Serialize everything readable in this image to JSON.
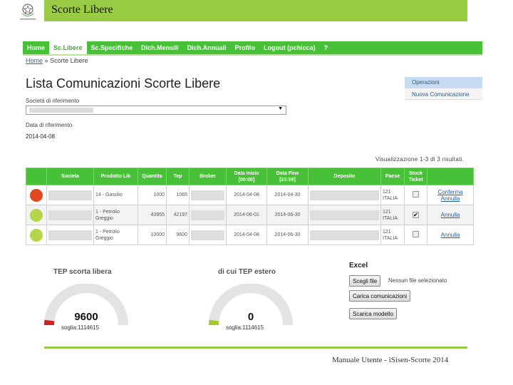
{
  "slide": {
    "title": "Scorte Libere",
    "footer": "Manuale Utente - iSisen-Scorte 2014"
  },
  "nav": {
    "items": [
      {
        "label": "Home",
        "active": false
      },
      {
        "label": "Sc.Libere",
        "active": true
      },
      {
        "label": "Sc.Specifiche",
        "active": false
      },
      {
        "label": "Dich.Mensili",
        "active": false
      },
      {
        "label": "Dich.Annuali",
        "active": false
      },
      {
        "label": "Profilo",
        "active": false
      },
      {
        "label": "Logout (pchicca)",
        "active": false
      },
      {
        "label": "?",
        "active": false
      }
    ]
  },
  "breadcrumb": {
    "home": "Home",
    "separator": "»",
    "current": "Scorte Libere"
  },
  "page": {
    "title": "Lista Comunicazioni Scorte Libere",
    "company_label": "Società di riferimento",
    "date_label": "Data di riferimento",
    "date_value": "2014-04-08",
    "results_info": "Visualizzazione 1-3 di 3 risultati."
  },
  "side_panel": {
    "heading": "Operazioni",
    "link": "Nuova Comunicazione"
  },
  "table": {
    "columns": [
      "",
      "Societa",
      "Prodotto Lib",
      "Quantita",
      "Tep",
      "Broker",
      "Data Inizio\n[00:00]",
      "Data Fine\n[23:59]",
      "Deposito",
      "Paese",
      "Stock Ticket",
      ""
    ],
    "rows": [
      {
        "status": "red",
        "prodotto": "14 - Gasolio",
        "quantita": "1000",
        "tep": "1065",
        "data_inizio": "2014-04-08",
        "data_fine": "2014-04-30",
        "paese": "121 ITALIA",
        "stock_ticket": false,
        "actions": [
          "Conferma",
          "Annulla"
        ]
      },
      {
        "status": "green",
        "prodotto": "1 - Petrolio Greggio",
        "quantita": "43955",
        "tep": "42197",
        "data_inizio": "2014-06-01",
        "data_fine": "2014-06-30",
        "paese": "121 ITALIA",
        "stock_ticket": true,
        "actions": [
          "Annulla"
        ]
      },
      {
        "status": "green",
        "prodotto": "1 - Petrolio Greggio",
        "quantita": "10000",
        "tep": "9600",
        "data_inizio": "2014-04-08",
        "data_fine": "2014-06-30",
        "paese": "121 ITALIA",
        "stock_ticket": false,
        "actions": [
          "Annulla"
        ]
      }
    ]
  },
  "gauges": [
    {
      "title": "TEP scorta libera",
      "value": "9600",
      "threshold_text": "soglia:1114615",
      "fill_fraction": 0.0086,
      "color": "#cc2222"
    },
    {
      "title": "di cui TEP estero",
      "value": "0",
      "threshold_text": "soglia:1114615",
      "fill_fraction": 0.0,
      "color": "#a8c830"
    }
  ],
  "excel": {
    "heading": "Excel",
    "choose_file": "Scegli file",
    "file_status": "Nessun file selezionato",
    "upload": "Carica comunicazioni",
    "download": "Scarica modello"
  },
  "colors": {
    "accent_green": "#48c038",
    "title_bar": "#99cc44",
    "status_red": "#e04822",
    "status_green": "#b6d64a"
  }
}
